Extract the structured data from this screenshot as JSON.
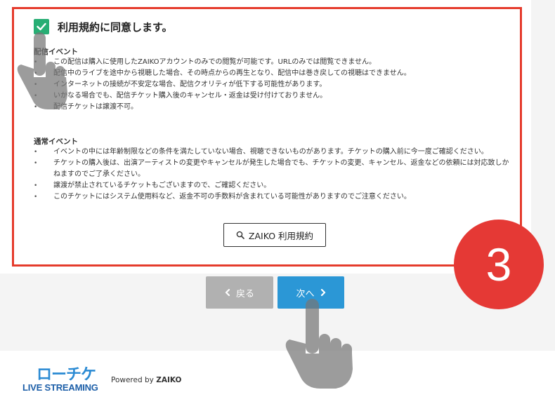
{
  "agreement": {
    "checked": true,
    "label": "利用規約に同意します。"
  },
  "sections": [
    {
      "title": "配信イベント",
      "items": [
        "この配信は購入に使用したZAIKOアカウントのみでの閲覧が可能です。URLのみでは閲覧できません。",
        "配信中のライブを途中から視聴した場合、その時点からの再生となり、配信中は巻き戻しての視聴はできません。",
        "インターネットの接続が不安定な場合、配信クオリティが低下する可能性があります。",
        "いかなる場合でも、配信チケット購入後のキャンセル・返金は受け付けておりません。",
        "配信チケットは譲渡不可。"
      ]
    },
    {
      "title": "通常イベント",
      "items": [
        "イベントの中には年齢制限などの条件を満たしていない場合、視聴できないものがあります。チケットの購入前に今一度ご確認ください。",
        "チケットの購入後は、出演アーティストの変更やキャンセルが発生した場合でも、チケットの変更、キャンセル、返金などの依頼には対応致しかねますのでご了承ください。",
        "譲渡が禁止されているチケットもございますので、ご確認ください。",
        "このチケットにはシステム使用料など、返金不可の手数料が含まれている可能性がありますのでご注意ください。"
      ]
    }
  ],
  "terms_button": {
    "label": "ZAIKO 利用規約"
  },
  "step_badge": "3",
  "nav": {
    "back_label": "戻る",
    "next_label": "次へ"
  },
  "footer": {
    "logo_top": "ローチケ",
    "logo_bottom": "LIVE STREAMING",
    "powered_prefix": "Powered by",
    "powered_brand": "ZAIKO"
  },
  "colors": {
    "highlight": "#e53b2c",
    "checkbox": "#27ae74",
    "next_button": "#2b97d6",
    "back_button": "#b1b1b1",
    "badge": "#e53935"
  },
  "icons": [
    "check-icon",
    "search-icon",
    "chevron-left-icon",
    "chevron-right-icon",
    "pointing-hand-icon"
  ]
}
